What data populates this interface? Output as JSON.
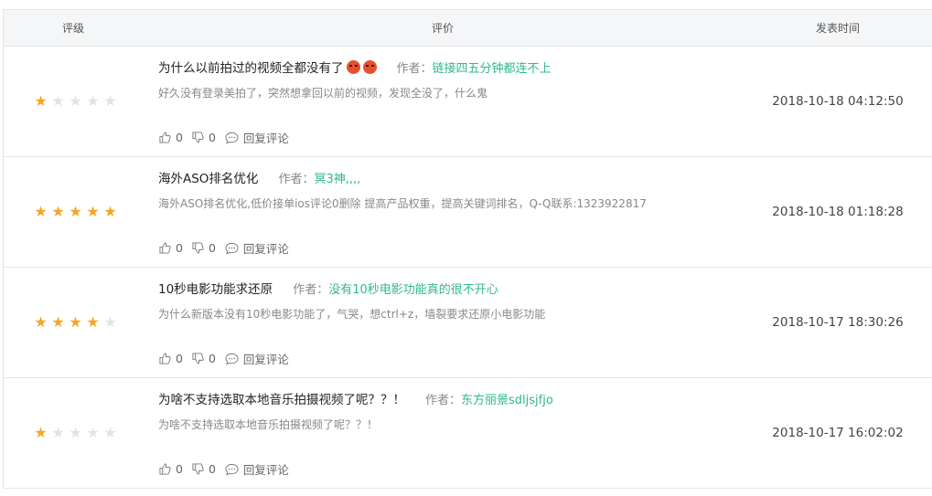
{
  "header": {
    "rating": "评级",
    "review": "评价",
    "time": "发表时间"
  },
  "author_prefix": "作者：",
  "actions": {
    "reply_label": "回复评论"
  },
  "rows": [
    {
      "stars": 1,
      "title": "为什么以前拍过的视频全都没有了",
      "emojis": [
        "angry-face-icon",
        "angry-face-icon"
      ],
      "author": "链接四五分钟都连不上",
      "content": "好久没有登录美拍了，突然想拿回以前的视频，发现全没了，什么鬼",
      "likes": "0",
      "dislikes": "0",
      "time": "2018-10-18 04:12:50"
    },
    {
      "stars": 5,
      "title": "海外ASO排名优化",
      "author": "冥3神,,,,",
      "content": "海外ASO排名优化,低价接单ios评论0删除 提高产品权重，提高关键词排名，Q-Q联系:1323922817",
      "likes": "0",
      "dislikes": "0",
      "time": "2018-10-18 01:18:28"
    },
    {
      "stars": 4,
      "title": "10秒电影功能求还原",
      "author": "没有10秒电影功能真的很不开心",
      "content": "为什么新版本没有10秒电影功能了，气哭，想ctrl+z，墙裂要求还原小电影功能",
      "likes": "0",
      "dislikes": "0",
      "time": "2018-10-17 18:30:26"
    },
    {
      "stars": 1,
      "title": "为啥不支持选取本地音乐拍摄视频了呢？？！",
      "author": "东方丽景sdljsjfjo",
      "content": "为啥不支持选取本地音乐拍摄视频了呢？？！",
      "likes": "0",
      "dislikes": "0",
      "time": "2018-10-17 16:02:02"
    }
  ],
  "colors": {
    "star_on": "#f5a623",
    "star_off": "#e3e3e3",
    "author": "#2fb88c",
    "header_bg": "#f5f6f8"
  }
}
